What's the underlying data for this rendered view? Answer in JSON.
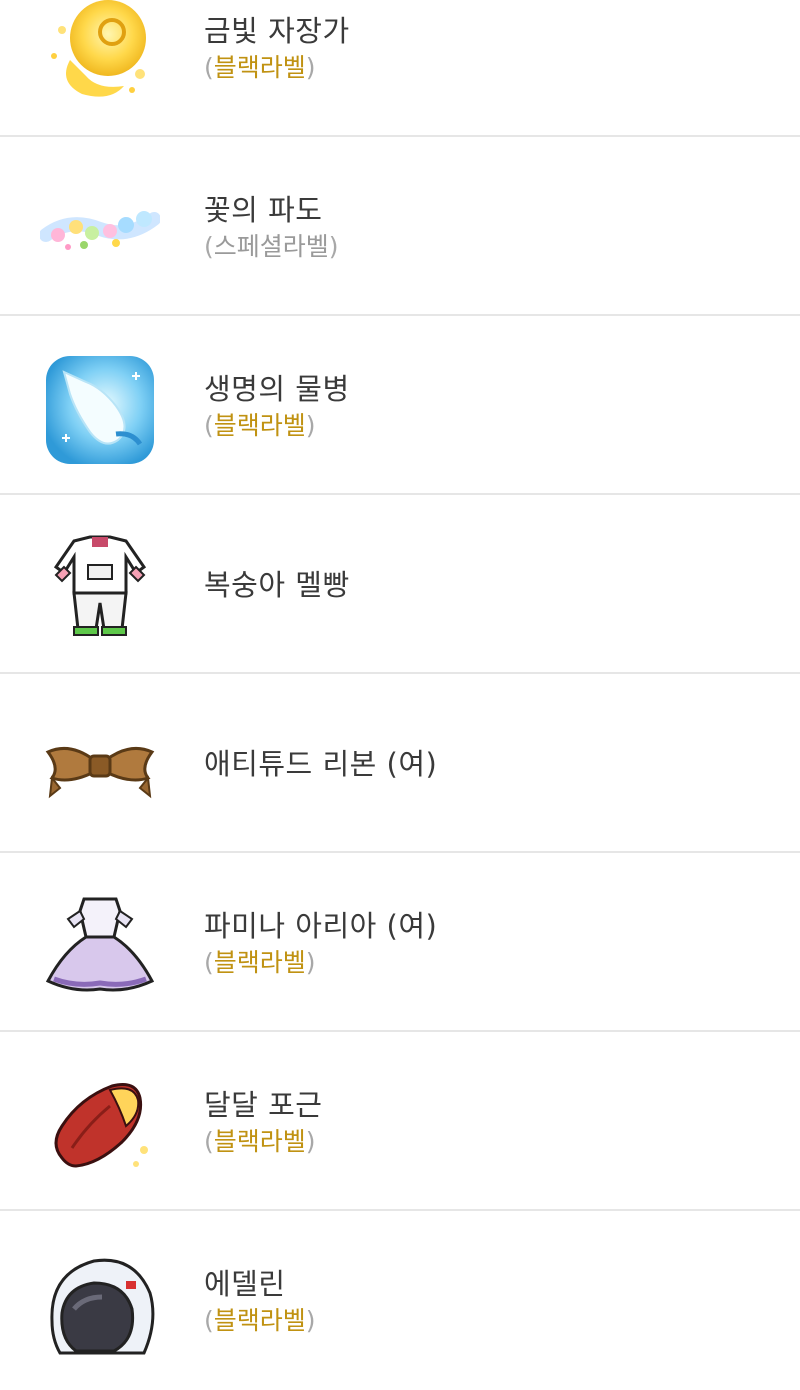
{
  "items": [
    {
      "name": "금빛 자장가",
      "label": "블랙라벨",
      "label_type": "black",
      "icon": "golden-moon-icon"
    },
    {
      "name": "꽃의 파도",
      "label": "스페셜라벨",
      "label_type": "special",
      "icon": "flower-wave-icon"
    },
    {
      "name": "생명의 물병",
      "label": "블랙라벨",
      "label_type": "black",
      "icon": "water-bottle-icon"
    },
    {
      "name": "복숭아 멜빵",
      "label": "",
      "label_type": "none",
      "icon": "peach-overalls-icon"
    },
    {
      "name": "애티튜드 리본 (여)",
      "label": "",
      "label_type": "none",
      "icon": "brown-ribbon-icon"
    },
    {
      "name": "파미나 아리아 (여)",
      "label": "블랙라벨",
      "label_type": "black",
      "icon": "purple-dress-icon"
    },
    {
      "name": "달달 포근",
      "label": "블랙라벨",
      "label_type": "black",
      "icon": "sweet-potato-icon"
    },
    {
      "name": "에델린",
      "label": "블랙라벨",
      "label_type": "black",
      "icon": "helmet-icon"
    }
  ],
  "paren_open": "(",
  "paren_close": ")",
  "colors": {
    "black_label": "#c09212",
    "special_label": "#9a9a9a",
    "divider": "#e6e6e6"
  }
}
